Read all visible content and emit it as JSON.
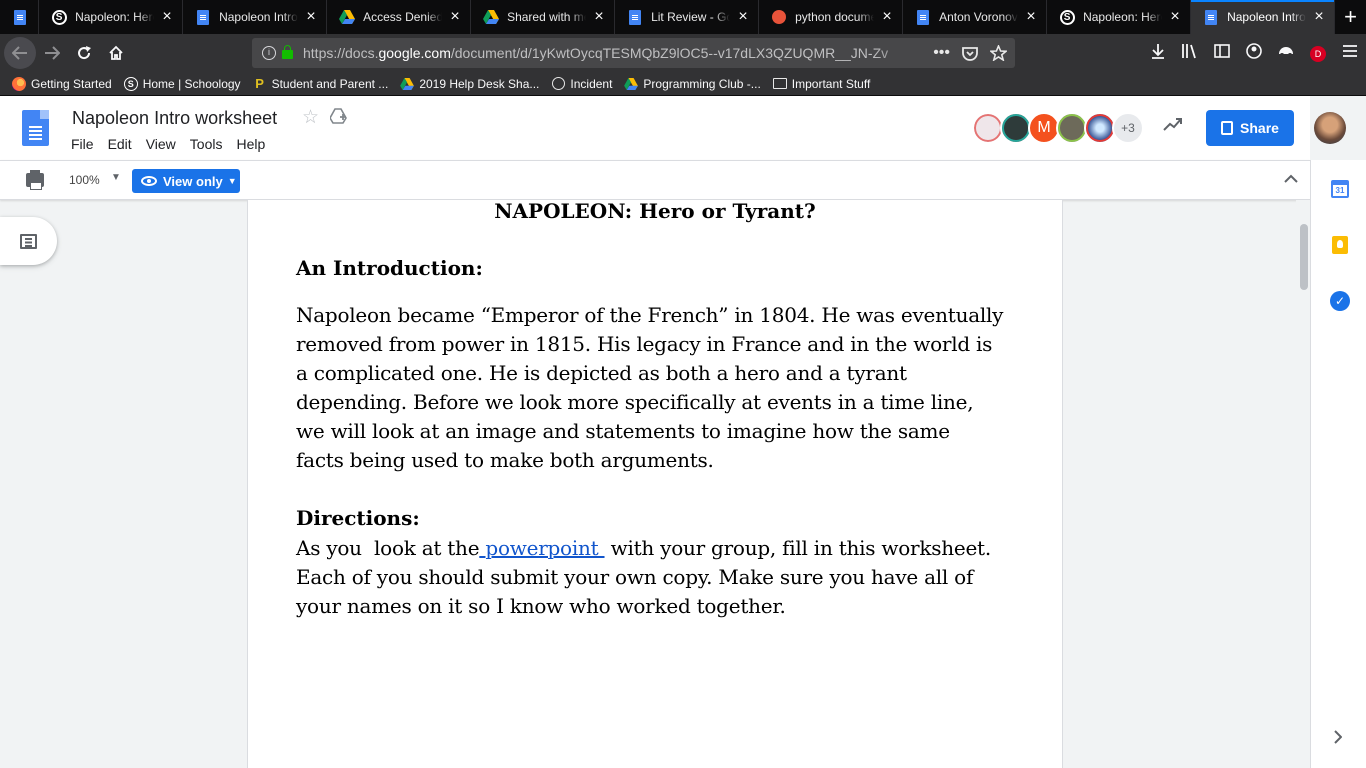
{
  "browser": {
    "tabs": [
      {
        "title": "",
        "icon": "docs-icon"
      },
      {
        "title": "Napoleon: Hero or Tyrant?",
        "icon": "schoology-icon"
      },
      {
        "title": "Napoleon Intro worksheet",
        "icon": "docs-icon"
      },
      {
        "title": "Access Denied",
        "icon": "drive-icon"
      },
      {
        "title": "Shared with me",
        "icon": "drive-icon"
      },
      {
        "title": "Lit Review - Google Docs",
        "icon": "docs-icon"
      },
      {
        "title": "python documentation",
        "icon": "duckduckgo-icon"
      },
      {
        "title": "Anton Voronov - ",
        "icon": "docs-icon"
      },
      {
        "title": "Napoleon: Hero or Tyrant?",
        "icon": "schoology-icon"
      },
      {
        "title": "Napoleon Intro worksheet",
        "icon": "docs-icon",
        "active": true
      }
    ],
    "url_prefix": "https://docs.",
    "url_host": "google.com",
    "url_path": "/document/d/1yKwtOycqTESMQbZ9lOC5--v17dLX3QZUQMR__JN-Zv",
    "profile_badge": "D",
    "bookmarks": [
      {
        "label": "Getting Started",
        "icon": "firefox-icon"
      },
      {
        "label": "Home | Schoology",
        "icon": "schoology-icon"
      },
      {
        "label": "Student and Parent ...",
        "icon": "p-icon"
      },
      {
        "label": "2019 Help Desk Sha...",
        "icon": "drive-icon"
      },
      {
        "label": "Incident",
        "icon": "globe-icon"
      },
      {
        "label": "Programming Club -...",
        "icon": "drive-icon"
      },
      {
        "label": "Important Stuff",
        "icon": "folder-icon"
      }
    ]
  },
  "docs": {
    "title": "Napoleon Intro worksheet",
    "menu": [
      "File",
      "Edit",
      "View",
      "Tools",
      "Help"
    ],
    "avatar_letter": "M",
    "more_viewers": "+3",
    "share_label": "Share",
    "zoom": "100%",
    "view_mode": "View only",
    "accent": "#1a73e8"
  },
  "document": {
    "heading": "NAPOLEON: Hero or Tyrant?",
    "intro_heading": "An Introduction:",
    "intro_lines": [
      "Napoleon became “Emperor of the French” in 1804. He was eventually",
      "removed from power in 1815. His legacy in France and in the world is",
      "a complicated one. He is depicted as both a hero and a tyrant",
      "depending. Before we look more specifically at events in a time line,",
      "we will look at an image and statements to imagine how the same",
      "facts being used to make both arguments."
    ],
    "directions_heading": "Directions:",
    "directions_line1_before": "As you  look at the",
    "directions_link": " powerpoint ",
    "directions_line1_after": " with your group, fill in this worksheet.",
    "directions_lines": [
      "Each of you should submit your own copy. Make sure you have all of",
      "your names on it so I know who worked together."
    ],
    "link_color": "#1155cc"
  },
  "side_panel": {
    "calendar_day": "31"
  }
}
